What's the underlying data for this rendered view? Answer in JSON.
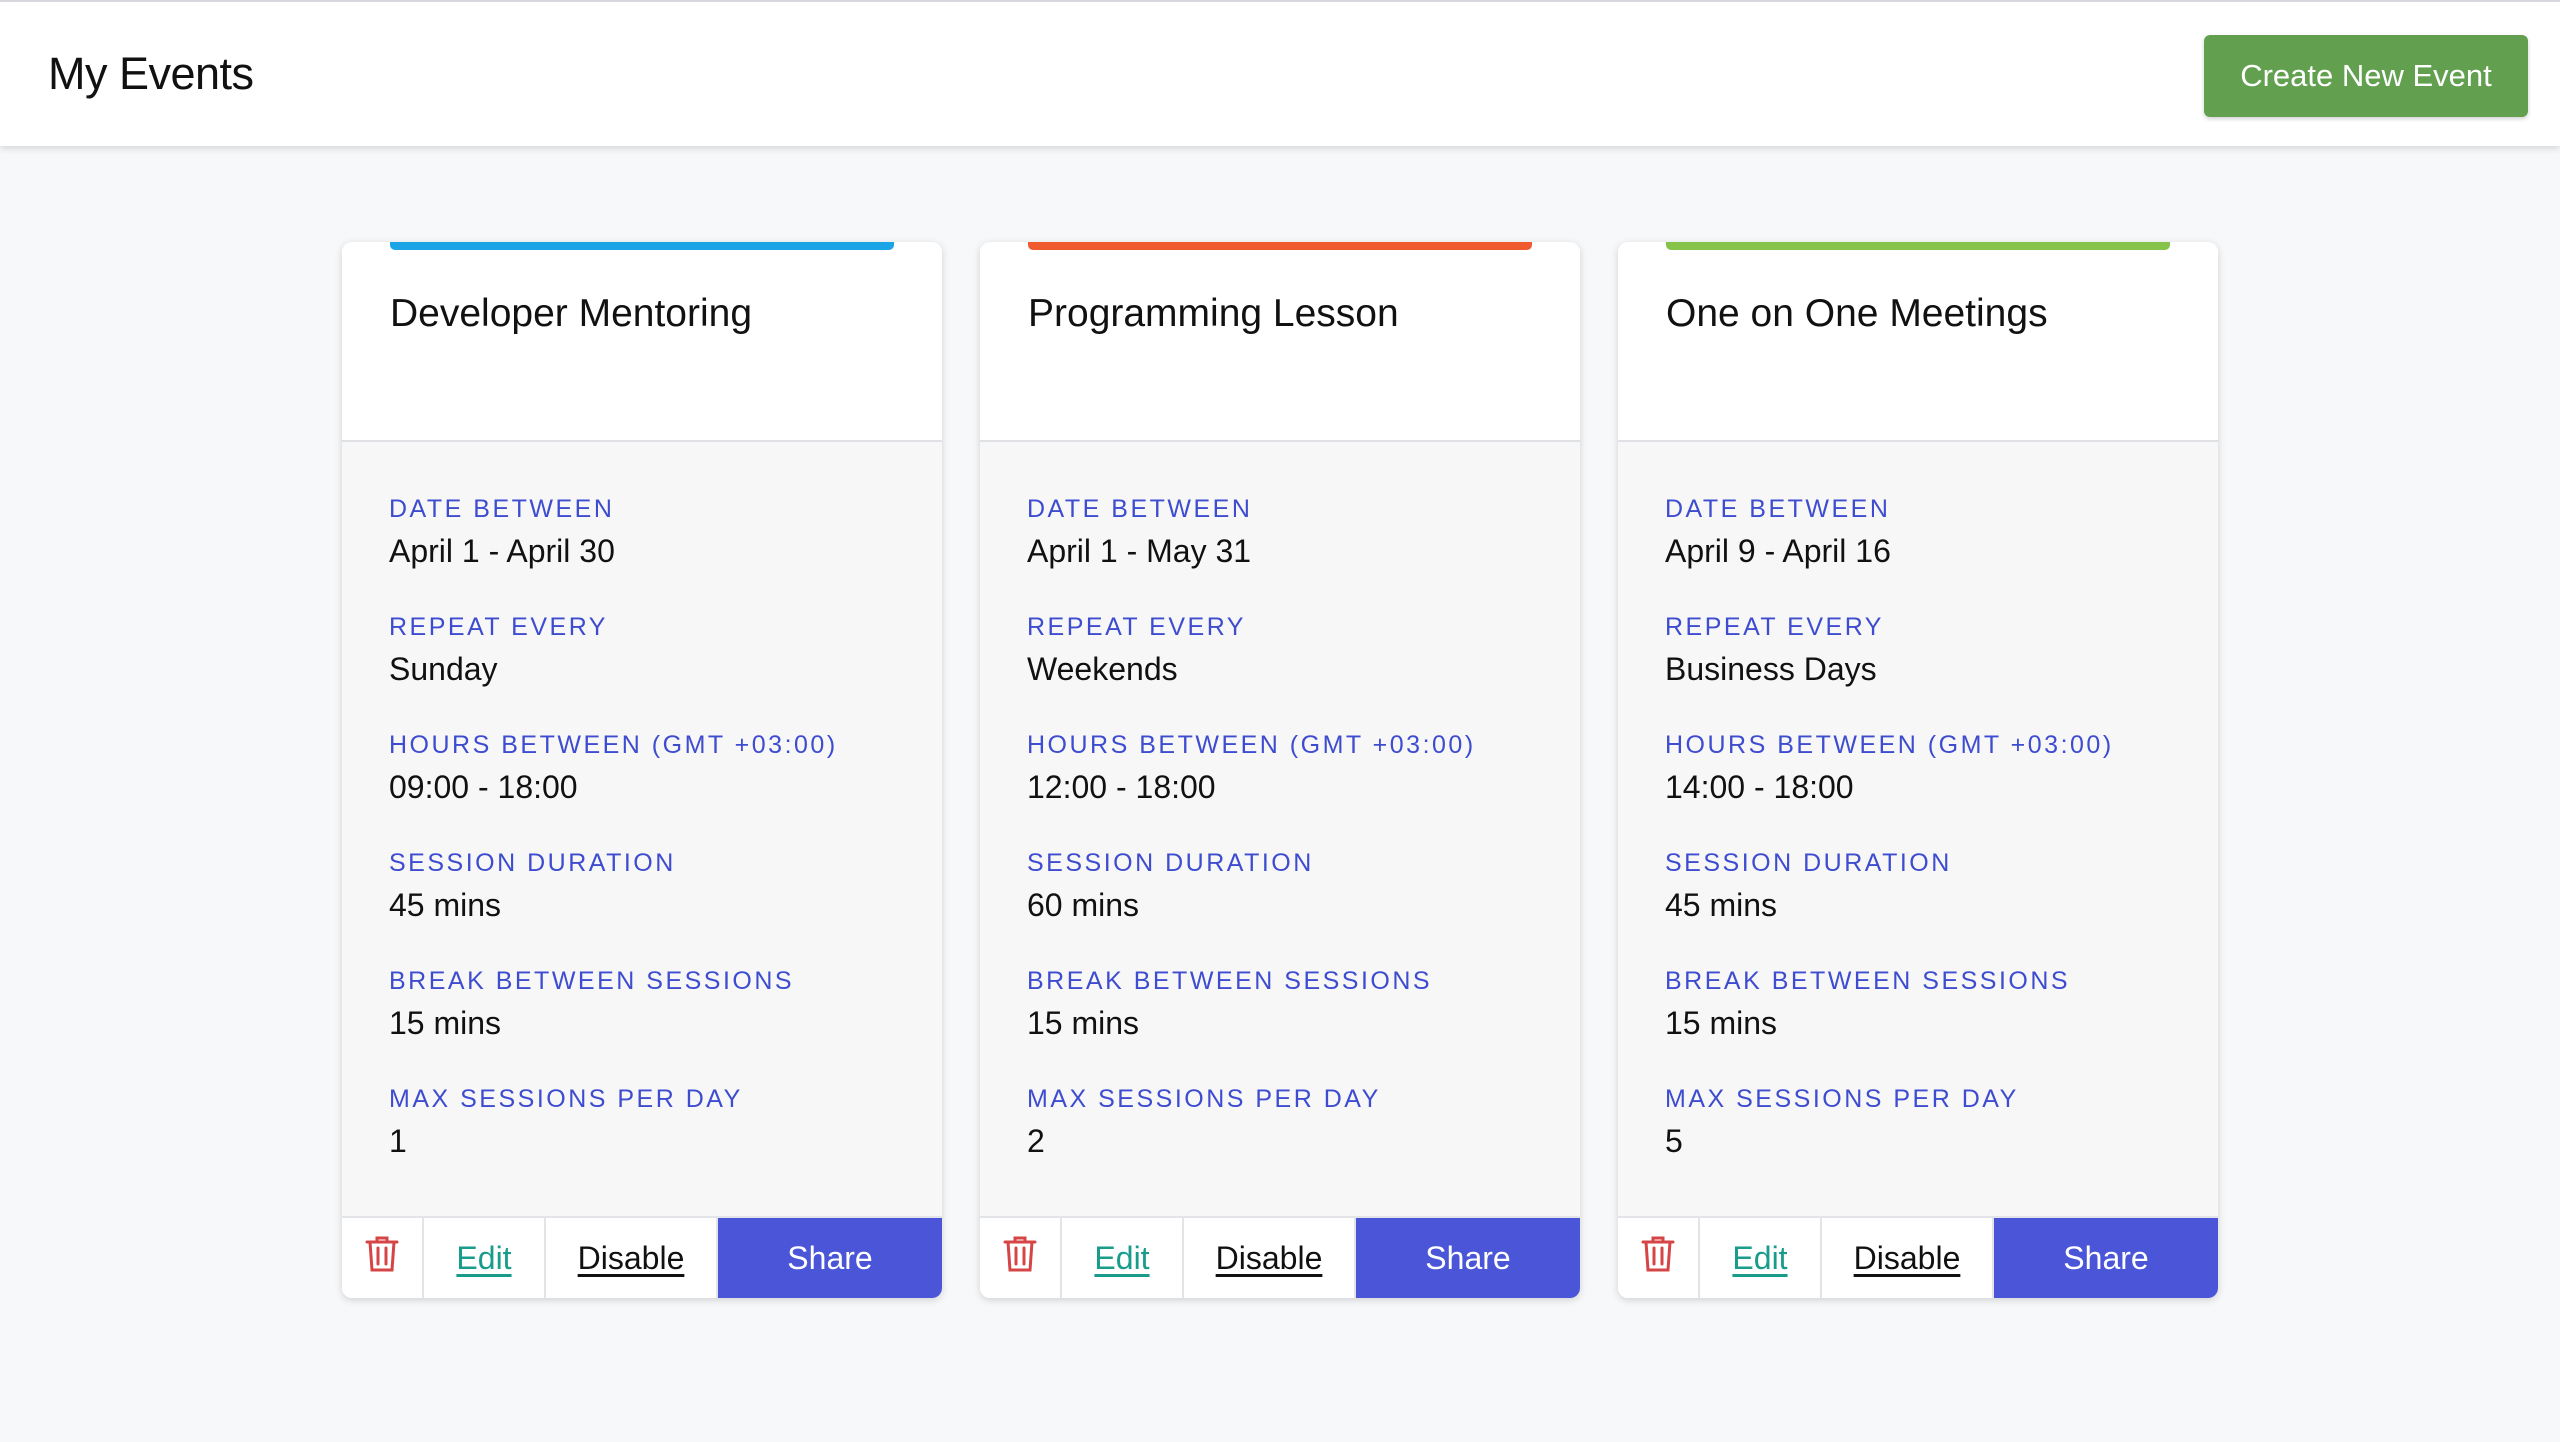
{
  "header": {
    "title": "My Events",
    "create_button_label": "Create New Event",
    "create_button_color": "#62a050"
  },
  "colors": {
    "field_label": "#3e4ccf",
    "edit_link": "#1a9c8c",
    "share_button": "#4a55d8",
    "delete_icon": "#d64545"
  },
  "labels": {
    "date_between": "DATE BETWEEN",
    "repeat_every": "REPEAT EVERY",
    "hours_between": "HOURS BETWEEN (GMT +03:00)",
    "session_duration": "SESSION DURATION",
    "break_between": "BREAK BETWEEN SESSIONS",
    "max_sessions": "MAX SESSIONS PER DAY"
  },
  "actions": {
    "delete_icon": "trash-icon",
    "edit": "Edit",
    "disable": "Disable",
    "share": "Share"
  },
  "events": [
    {
      "title": "Developer Mentoring",
      "accent_color": "#1ba5e6",
      "date_between": "April 1 - April 30",
      "repeat_every": "Sunday",
      "hours_between": "09:00 - 18:00",
      "session_duration": "45 mins",
      "break_between": "15 mins",
      "max_sessions": "1"
    },
    {
      "title": "Programming Lesson",
      "accent_color": "#ef5a2f",
      "date_between": "April 1 - May 31",
      "repeat_every": "Weekends",
      "hours_between": "12:00 - 18:00",
      "session_duration": "60 mins",
      "break_between": "15 mins",
      "max_sessions": "2"
    },
    {
      "title": "One on One Meetings",
      "accent_color": "#86c34a",
      "date_between": "April 9 - April 16",
      "repeat_every": "Business Days",
      "hours_between": "14:00 - 18:00",
      "session_duration": "45 mins",
      "break_between": "15 mins",
      "max_sessions": "5"
    }
  ]
}
